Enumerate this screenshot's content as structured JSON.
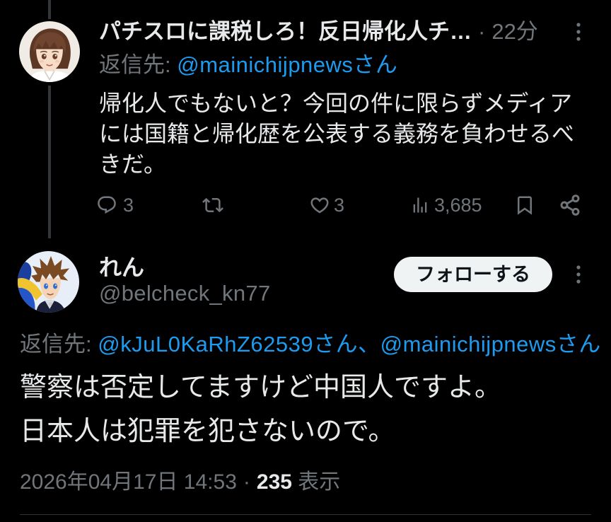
{
  "colors": {
    "background": "#000000",
    "text": "#e7e9ea",
    "secondary_text": "#71767b",
    "link": "#1d9bf0",
    "thread_line": "#333639",
    "divider": "#2f3336",
    "follow_button_bg": "#eff3f4",
    "follow_button_text": "#0f1419"
  },
  "icons": {
    "more": "more-vertical-icon",
    "reply": "reply-icon",
    "repost": "repost-icon",
    "like": "heart-icon",
    "views": "views-icon",
    "bookmark": "bookmark-icon",
    "share": "share-icon"
  },
  "thread": {
    "parent": {
      "author_name": "パチスロに課税しろ！反日帰化人チ…",
      "separator": "·",
      "time_ago": "22分",
      "reply_to_label": "返信先:",
      "reply_to_handles": "@mainichijpnewsさん",
      "body_lines": [
        "帰化人でもないと？今回の件に限らずメディア",
        "には国籍と帰化歴を公表する義務を負わせるべ",
        "きだ。"
      ],
      "reply_count": "3",
      "like_count": "3",
      "view_count": "3,685"
    },
    "main": {
      "author_name": "れん",
      "handle": "@belcheck_kn77",
      "follow_label": "フォローする",
      "reply_to_label": "返信先:",
      "reply_to_handles": "@kJuL0KaRhZ62539さん、@mainichijpnewsさん",
      "body_lines": [
        "警察は否定してますけど中国人ですよ。",
        "日本人は犯罪を犯さないので。"
      ],
      "timestamp": "2026年04月17日 14:53",
      "separator": "·",
      "view_count": "235",
      "view_label": "表示"
    }
  }
}
